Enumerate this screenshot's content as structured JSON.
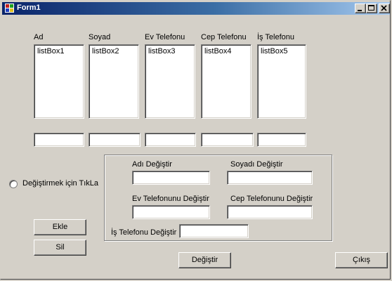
{
  "window": {
    "title": "Form1",
    "icon": "app-icon",
    "controls": {
      "minimize": "minimize-icon",
      "maximize": "maximize-icon",
      "close": "close-icon"
    }
  },
  "columns": [
    {
      "header": "Ad",
      "listbox": "listBox1",
      "textbox_value": ""
    },
    {
      "header": "Soyad",
      "listbox": "listBox2",
      "textbox_value": ""
    },
    {
      "header": "Ev Telefonu",
      "listbox": "listBox3",
      "textbox_value": ""
    },
    {
      "header": "Cep Telefonu",
      "listbox": "listBox4",
      "textbox_value": ""
    },
    {
      "header": "İş Telefonu",
      "listbox": "listBox5",
      "textbox_value": ""
    }
  ],
  "radio": {
    "label": "Değiştirmek için TıkLa",
    "checked": false
  },
  "buttons": {
    "add": "Ekle",
    "delete": "Sil",
    "change": "Değiştir",
    "exit": "Çıkış"
  },
  "edit_group": {
    "name_label": "Adı Değiştir",
    "surname_label": "Soyadı Değiştir",
    "home_phone_label": "Ev Telefonunu Değiştir",
    "mobile_phone_label": "Cep Telefonunu Değiştir",
    "work_phone_label": "İş Telefonu Değiştir"
  }
}
